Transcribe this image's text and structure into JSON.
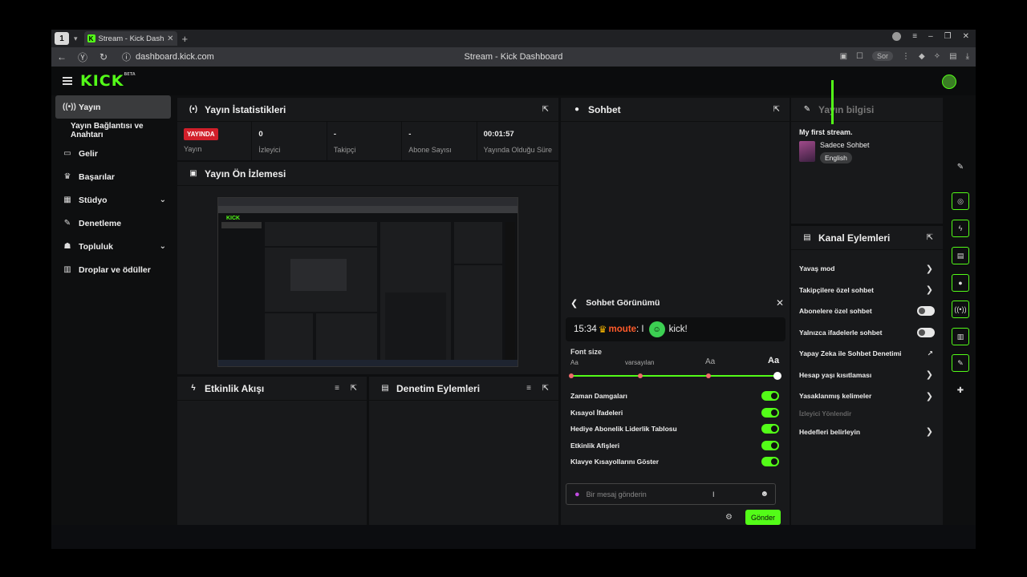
{
  "browser": {
    "tab_count": "1",
    "tab_title": "Stream - Kick Dashboard",
    "url": "dashboard.kick.com",
    "window_title": "Stream - Kick Dashboard",
    "sor_label": "Sor"
  },
  "brand": {
    "logo": "KICK",
    "beta": "BETA",
    "accent": "#53fc18"
  },
  "sidebar": {
    "items": [
      {
        "label": "Yayın",
        "icon": "broadcast-icon",
        "active": true
      },
      {
        "label": "Yayın Bağlantısı ve Anahtarı",
        "icon": "",
        "sub": true
      },
      {
        "label": "Gelir",
        "icon": "money-icon"
      },
      {
        "label": "Başarılar",
        "icon": "trophy-icon"
      },
      {
        "label": "Stüdyo",
        "icon": "studio-icon",
        "expandable": true
      },
      {
        "label": "Denetleme",
        "icon": "wrench-icon"
      },
      {
        "label": "Topluluk",
        "icon": "people-icon",
        "expandable": true
      },
      {
        "label": "Droplar ve ödüller",
        "icon": "gift-icon"
      }
    ]
  },
  "stats_panel": {
    "title": "Yayın İstatistikleri",
    "live_badge": "YAYINDA",
    "stats": [
      {
        "value": "",
        "label": "Yayın"
      },
      {
        "value": "0",
        "label": "İzleyici"
      },
      {
        "value": "-",
        "label": "Takipçi"
      },
      {
        "value": "-",
        "label": "Abone Sayısı"
      },
      {
        "value": "00:01:57",
        "label": "Yayında Olduğu Süre"
      }
    ]
  },
  "preview_panel": {
    "title": "Yayın Ön İzlemesi"
  },
  "activity_panel": {
    "title": "Etkinlik Akışı"
  },
  "mod_actions_panel": {
    "title": "Denetim Eylemleri"
  },
  "chat_panel": {
    "title": "Sohbet",
    "settings": {
      "title": "Sohbet Görünümü",
      "preview_time": "15:34",
      "preview_user": "moute",
      "preview_text": "kick!",
      "font_size_label": "Font size",
      "font_stops": [
        "Aa",
        "varsayılan",
        "Aa",
        "Aa"
      ],
      "font_size_index": 3,
      "toggles": [
        {
          "label": "Zaman Damgaları",
          "on": true
        },
        {
          "label": "Kısayol İfadeleri",
          "on": true
        },
        {
          "label": "Hediye Abonelik Liderlik Tablosu",
          "on": true
        },
        {
          "label": "Etkinlik Afişleri",
          "on": true
        },
        {
          "label": "Klavye Kısayollarını Göster",
          "on": true
        }
      ]
    },
    "input_placeholder": "Bir mesaj gönderin",
    "send_label": "Gönder"
  },
  "info_panel": {
    "title": "Yayın bilgisi",
    "stream_title": "My first stream.",
    "category": "Sadece Sohbet",
    "language": "English"
  },
  "channel_actions": {
    "title": "Kanal Eylemleri",
    "rows": [
      {
        "label": "Yavaş mod",
        "type": "chevron"
      },
      {
        "label": "Takipçilere özel sohbet",
        "type": "chevron"
      },
      {
        "label": "Abonelere özel sohbet",
        "type": "toggle-off"
      },
      {
        "label": "Yalnızca ifadelerle sohbet",
        "type": "toggle-off"
      },
      {
        "label": "Yapay Zeka ile Sohbet Denetimi",
        "type": "external"
      },
      {
        "label": "Hesap yaşı kısıtlaması",
        "type": "chevron"
      },
      {
        "label": "Yasaklanmış kelimeler",
        "type": "chevron"
      },
      {
        "label": "İzleyici Yönlendir",
        "type": "dim"
      },
      {
        "label": "Hedefleri belirleyin",
        "type": "chevron"
      }
    ]
  }
}
